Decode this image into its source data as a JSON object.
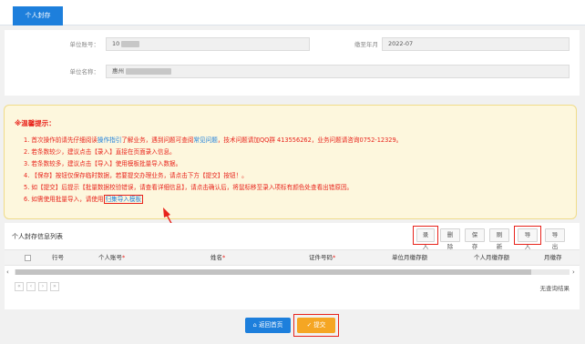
{
  "tab": {
    "label": "个人封存"
  },
  "form": {
    "unit_account_label": "单位账号：",
    "unit_account_value": "10",
    "deadline_label": "缴至年月",
    "deadline_value": "2022-07",
    "unit_name_label": "单位名称：",
    "unit_name_value": "惠州"
  },
  "notice": {
    "title": "※温馨提示：",
    "line1_a": "1. 首次操作前请先仔细阅读",
    "line1_link": "操作指引",
    "line1_b": "了解业务，遇到问题可查阅",
    "line1_link2": "常见问题",
    "line1_c": "，技术问题请加QQ群 413556262，业务问题请咨询0752-12329。",
    "line2": "2. 若条数较少，建议点击【录入】直接在页面录入信息。",
    "line3": "3. 若条数较多，建议点击【导入】使用模板批量导入数据。",
    "line4": "4. 【保存】按钮仅保存临时数据，若要提交办理业务，请点击下方【提交】按钮！。",
    "line5": "5. 如【提交】后提示【批量数据校验错误，请查看详细信息】，请点击确认后，将鼠标移至录入项标有颜色处查看出错原因。",
    "line6_a": "6. 如需使用批量导入，请使用",
    "line6_link": "归集导入模板"
  },
  "list": {
    "title": "个人封存信息列表",
    "buttons": {
      "add": "录入",
      "delete": "删除",
      "save": "保存",
      "refresh": "刷新",
      "import": "导入",
      "export": "导出"
    },
    "columns": [
      "行号",
      "个人账号",
      "姓名",
      "证件号码",
      "单位月缴存额",
      "个人月缴存额",
      "月缴存"
    ],
    "empty_text": "无查询结果"
  },
  "footer": {
    "home_label": "返回首页",
    "submit_label": "提交"
  },
  "colors": {
    "primary": "#1d7fdc",
    "warning": "#f5a623",
    "alert": "#e8231b"
  }
}
